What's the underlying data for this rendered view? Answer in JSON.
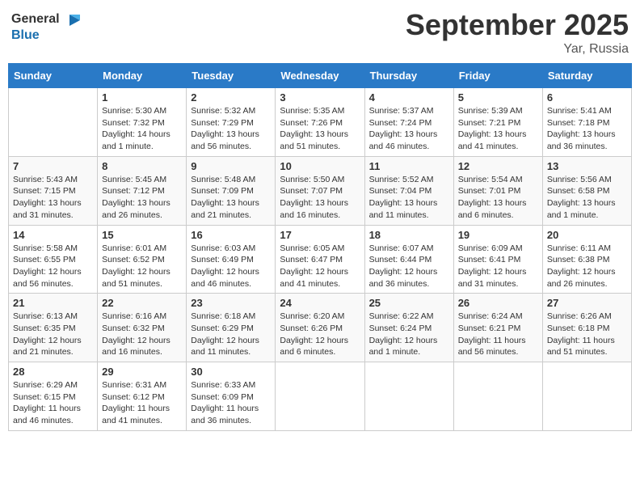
{
  "app": {
    "logo_general": "General",
    "logo_blue": "Blue",
    "month": "September 2025",
    "location": "Yar, Russia"
  },
  "columns": [
    "Sunday",
    "Monday",
    "Tuesday",
    "Wednesday",
    "Thursday",
    "Friday",
    "Saturday"
  ],
  "weeks": [
    [
      {
        "day": "",
        "info": ""
      },
      {
        "day": "1",
        "info": "Sunrise: 5:30 AM\nSunset: 7:32 PM\nDaylight: 14 hours\nand 1 minute."
      },
      {
        "day": "2",
        "info": "Sunrise: 5:32 AM\nSunset: 7:29 PM\nDaylight: 13 hours\nand 56 minutes."
      },
      {
        "day": "3",
        "info": "Sunrise: 5:35 AM\nSunset: 7:26 PM\nDaylight: 13 hours\nand 51 minutes."
      },
      {
        "day": "4",
        "info": "Sunrise: 5:37 AM\nSunset: 7:24 PM\nDaylight: 13 hours\nand 46 minutes."
      },
      {
        "day": "5",
        "info": "Sunrise: 5:39 AM\nSunset: 7:21 PM\nDaylight: 13 hours\nand 41 minutes."
      },
      {
        "day": "6",
        "info": "Sunrise: 5:41 AM\nSunset: 7:18 PM\nDaylight: 13 hours\nand 36 minutes."
      }
    ],
    [
      {
        "day": "7",
        "info": "Sunrise: 5:43 AM\nSunset: 7:15 PM\nDaylight: 13 hours\nand 31 minutes."
      },
      {
        "day": "8",
        "info": "Sunrise: 5:45 AM\nSunset: 7:12 PM\nDaylight: 13 hours\nand 26 minutes."
      },
      {
        "day": "9",
        "info": "Sunrise: 5:48 AM\nSunset: 7:09 PM\nDaylight: 13 hours\nand 21 minutes."
      },
      {
        "day": "10",
        "info": "Sunrise: 5:50 AM\nSunset: 7:07 PM\nDaylight: 13 hours\nand 16 minutes."
      },
      {
        "day": "11",
        "info": "Sunrise: 5:52 AM\nSunset: 7:04 PM\nDaylight: 13 hours\nand 11 minutes."
      },
      {
        "day": "12",
        "info": "Sunrise: 5:54 AM\nSunset: 7:01 PM\nDaylight: 13 hours\nand 6 minutes."
      },
      {
        "day": "13",
        "info": "Sunrise: 5:56 AM\nSunset: 6:58 PM\nDaylight: 13 hours\nand 1 minute."
      }
    ],
    [
      {
        "day": "14",
        "info": "Sunrise: 5:58 AM\nSunset: 6:55 PM\nDaylight: 12 hours\nand 56 minutes."
      },
      {
        "day": "15",
        "info": "Sunrise: 6:01 AM\nSunset: 6:52 PM\nDaylight: 12 hours\nand 51 minutes."
      },
      {
        "day": "16",
        "info": "Sunrise: 6:03 AM\nSunset: 6:49 PM\nDaylight: 12 hours\nand 46 minutes."
      },
      {
        "day": "17",
        "info": "Sunrise: 6:05 AM\nSunset: 6:47 PM\nDaylight: 12 hours\nand 41 minutes."
      },
      {
        "day": "18",
        "info": "Sunrise: 6:07 AM\nSunset: 6:44 PM\nDaylight: 12 hours\nand 36 minutes."
      },
      {
        "day": "19",
        "info": "Sunrise: 6:09 AM\nSunset: 6:41 PM\nDaylight: 12 hours\nand 31 minutes."
      },
      {
        "day": "20",
        "info": "Sunrise: 6:11 AM\nSunset: 6:38 PM\nDaylight: 12 hours\nand 26 minutes."
      }
    ],
    [
      {
        "day": "21",
        "info": "Sunrise: 6:13 AM\nSunset: 6:35 PM\nDaylight: 12 hours\nand 21 minutes."
      },
      {
        "day": "22",
        "info": "Sunrise: 6:16 AM\nSunset: 6:32 PM\nDaylight: 12 hours\nand 16 minutes."
      },
      {
        "day": "23",
        "info": "Sunrise: 6:18 AM\nSunset: 6:29 PM\nDaylight: 12 hours\nand 11 minutes."
      },
      {
        "day": "24",
        "info": "Sunrise: 6:20 AM\nSunset: 6:26 PM\nDaylight: 12 hours\nand 6 minutes."
      },
      {
        "day": "25",
        "info": "Sunrise: 6:22 AM\nSunset: 6:24 PM\nDaylight: 12 hours\nand 1 minute."
      },
      {
        "day": "26",
        "info": "Sunrise: 6:24 AM\nSunset: 6:21 PM\nDaylight: 11 hours\nand 56 minutes."
      },
      {
        "day": "27",
        "info": "Sunrise: 6:26 AM\nSunset: 6:18 PM\nDaylight: 11 hours\nand 51 minutes."
      }
    ],
    [
      {
        "day": "28",
        "info": "Sunrise: 6:29 AM\nSunset: 6:15 PM\nDaylight: 11 hours\nand 46 minutes."
      },
      {
        "day": "29",
        "info": "Sunrise: 6:31 AM\nSunset: 6:12 PM\nDaylight: 11 hours\nand 41 minutes."
      },
      {
        "day": "30",
        "info": "Sunrise: 6:33 AM\nSunset: 6:09 PM\nDaylight: 11 hours\nand 36 minutes."
      },
      {
        "day": "",
        "info": ""
      },
      {
        "day": "",
        "info": ""
      },
      {
        "day": "",
        "info": ""
      },
      {
        "day": "",
        "info": ""
      }
    ]
  ]
}
